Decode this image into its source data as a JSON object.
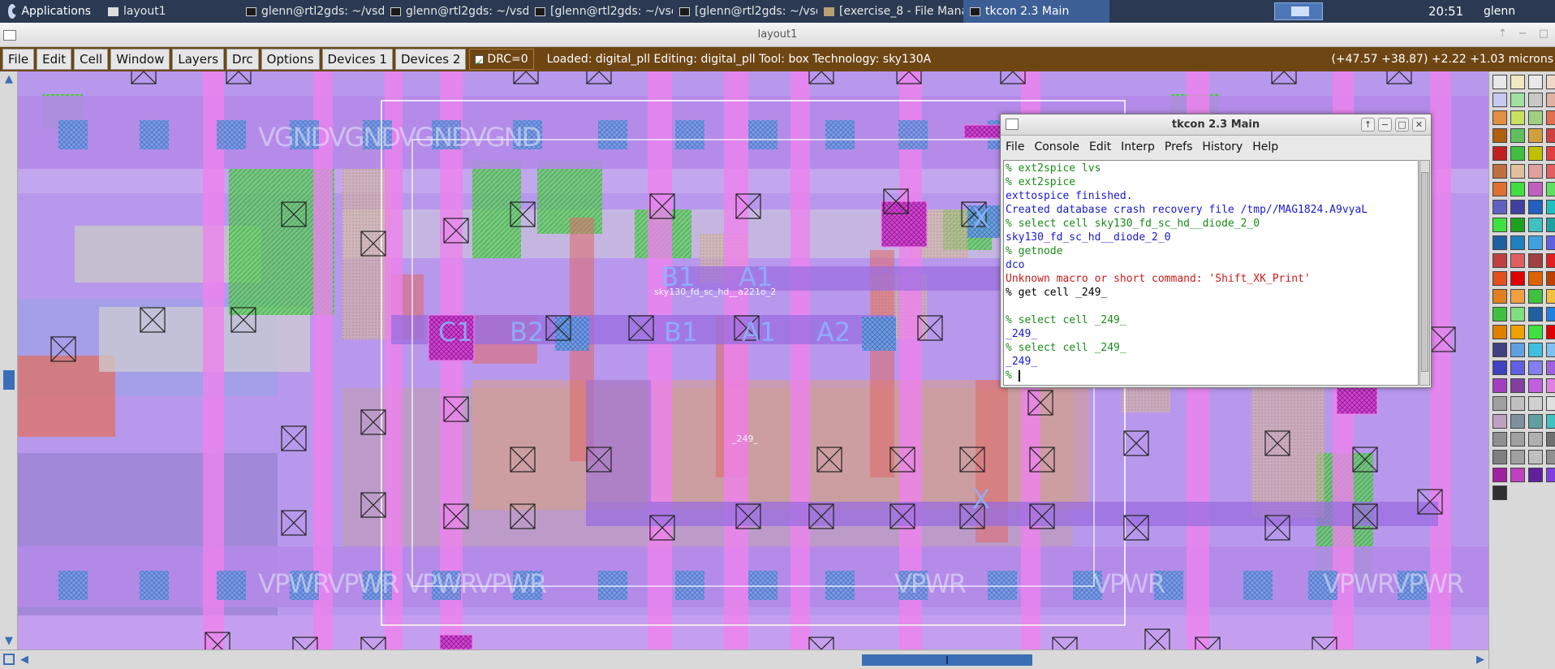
{
  "taskbar": {
    "apps_label": "Applications",
    "tasks": [
      {
        "label": "layout1",
        "icon": "window"
      },
      {
        "label": "glenn@rtl2gds: ~/vsd_l...",
        "icon": "terminal"
      },
      {
        "label": "glenn@rtl2gds: ~/vsd_l...",
        "icon": "terminal"
      },
      {
        "label": "[glenn@rtl2gds: ~/vsd_l...",
        "icon": "terminal"
      },
      {
        "label": "[glenn@rtl2gds: ~/vsd_l...",
        "icon": "terminal"
      },
      {
        "label": "[exercise_8 - File Mana...",
        "icon": "folder"
      },
      {
        "label": "tkcon 2.3 Main",
        "icon": "terminal",
        "active": true
      }
    ],
    "clock": "20:51",
    "user": "glenn"
  },
  "window": {
    "title": "layout1"
  },
  "magic_menu": {
    "buttons": [
      "File",
      "Edit",
      "Cell",
      "Window",
      "Layers",
      "Drc",
      "Options",
      "Devices 1",
      "Devices 2"
    ],
    "drc_label": "DRC=0",
    "status": "Loaded: digital_pll Editing: digital_pll Tool: box  Technology: sky130A",
    "coords": "(+47.57 +38.87) +2.22 +1.03 microns"
  },
  "layout_labels": {
    "gnd_text": "VGNDVGNDVGNDVGND",
    "vpwr_left": "VPWRVPWR",
    "vpwr_mid": "VPWRVPWR",
    "vpwr_right1": "VPWR",
    "vpwr_right2": "VPWR",
    "vpwr_right3": "VPWRVPWR",
    "pins": [
      "C1",
      "B2",
      "B1",
      "A1",
      "A2",
      "B1",
      "A1",
      "X",
      "X"
    ],
    "cell_name": "sky130_fd_sc_hd__a221o_2",
    "net_label": "_249_"
  },
  "tkcon": {
    "title": "tkcon 2.3 Main",
    "menu": [
      "File",
      "Console",
      "Edit",
      "Interp",
      "Prefs",
      "History",
      "Help"
    ],
    "lines": [
      {
        "text": "% ext2spice lvs",
        "color": "#1a8a1a",
        "prompt": true
      },
      {
        "text": "% ext2spice",
        "color": "#1a8a1a",
        "prompt": true
      },
      {
        "text": "exttospice finished.",
        "color": "#1a1acc"
      },
      {
        "text": "Created database crash recovery file /tmp//MAG1824.A9vyaL",
        "color": "#1a1acc"
      },
      {
        "text": "% select cell sky130_fd_sc_hd__diode_2_0",
        "color": "#1a8a1a",
        "prompt": true
      },
      {
        "text": "sky130_fd_sc_hd__diode_2_0",
        "color": "#1a1acc"
      },
      {
        "text": "% getnode",
        "color": "#1a8a1a",
        "prompt": true
      },
      {
        "text": "dco",
        "color": "#1a1acc"
      },
      {
        "text": "Unknown macro or short command: 'Shift_XK_Print'",
        "color": "#cc1a1a"
      },
      {
        "text": "% get cell _249_",
        "color": "#000000",
        "prompt": true
      },
      {
        "text": "",
        "color": "#000000"
      },
      {
        "text": "% select cell _249_",
        "color": "#1a8a1a",
        "prompt": true
      },
      {
        "text": "_249_",
        "color": "#1a1acc"
      },
      {
        "text": "% select cell _249_",
        "color": "#1a8a1a",
        "prompt": true
      },
      {
        "text": "_249_",
        "color": "#1a1acc"
      },
      {
        "text": "% ",
        "color": "#1a8a1a",
        "prompt": true,
        "cursor": true
      }
    ]
  },
  "colors": {
    "menubar_bg": "#6e4614",
    "taskbar_bg": "#2b3a52",
    "canvas_bg": "#a98ee0",
    "metal1": "#b98cf2",
    "poly": "#e06060",
    "locali": "#ee82ee"
  }
}
